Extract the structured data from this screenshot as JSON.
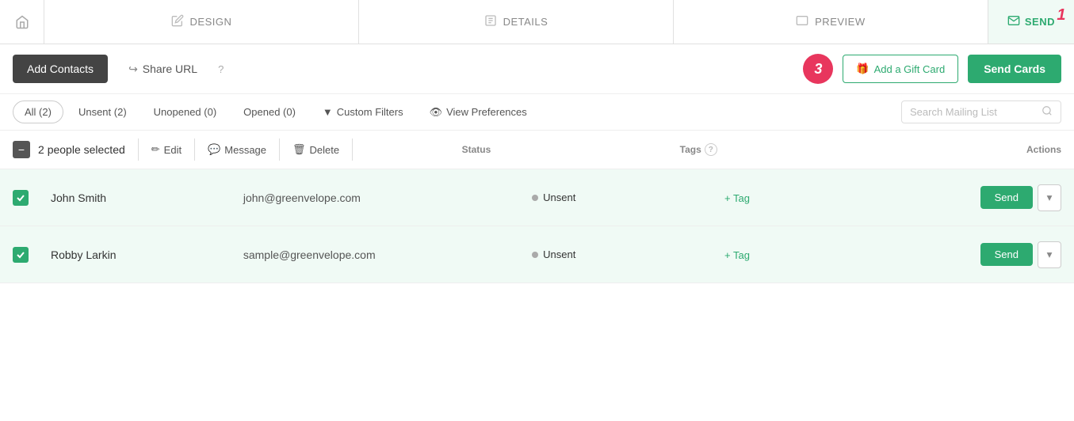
{
  "nav": {
    "home_icon": "⌂",
    "tabs": [
      {
        "id": "design",
        "label": "DESIGN",
        "icon": "✏"
      },
      {
        "id": "details",
        "label": "DETAILS",
        "icon": "☰"
      },
      {
        "id": "preview",
        "label": "PREVIEW",
        "icon": "▭"
      }
    ],
    "send_label": "SEND",
    "send_icon": "✉",
    "send_step": "1"
  },
  "toolbar": {
    "add_contacts_label": "Add Contacts",
    "share_url_label": "Share URL",
    "help_icon": "?",
    "step3_badge": "3",
    "gift_card_label": "Add a Gift Card",
    "gift_icon": "🎁",
    "send_cards_label": "Send Cards"
  },
  "filters": {
    "tabs": [
      {
        "id": "all",
        "label": "All (2)",
        "active": true
      },
      {
        "id": "unsent",
        "label": "Unsent (2)",
        "active": false
      },
      {
        "id": "unopened",
        "label": "Unopened (0)",
        "active": false
      },
      {
        "id": "opened",
        "label": "Opened (0)",
        "active": false
      }
    ],
    "custom_filters_label": "Custom Filters",
    "view_prefs_label": "View Preferences",
    "search_placeholder": "Search Mailing List"
  },
  "selection": {
    "count": "2",
    "people_selected_label": "people selected",
    "edit_label": "Edit",
    "message_label": "Message",
    "delete_label": "Delete"
  },
  "columns": {
    "status_label": "Status",
    "tags_label": "Tags",
    "actions_label": "Actions"
  },
  "contacts": [
    {
      "id": "john-smith",
      "name": "John Smith",
      "email": "john@greenvelope.com",
      "status": "Unsent",
      "tag_label": "+ Tag"
    },
    {
      "id": "robby-larkin",
      "name": "Robby Larkin",
      "email": "sample@greenvelope.com",
      "status": "Unsent",
      "tag_label": "+ Tag"
    }
  ],
  "row_actions": {
    "send_label": "Send",
    "chevron_icon": "▾"
  }
}
